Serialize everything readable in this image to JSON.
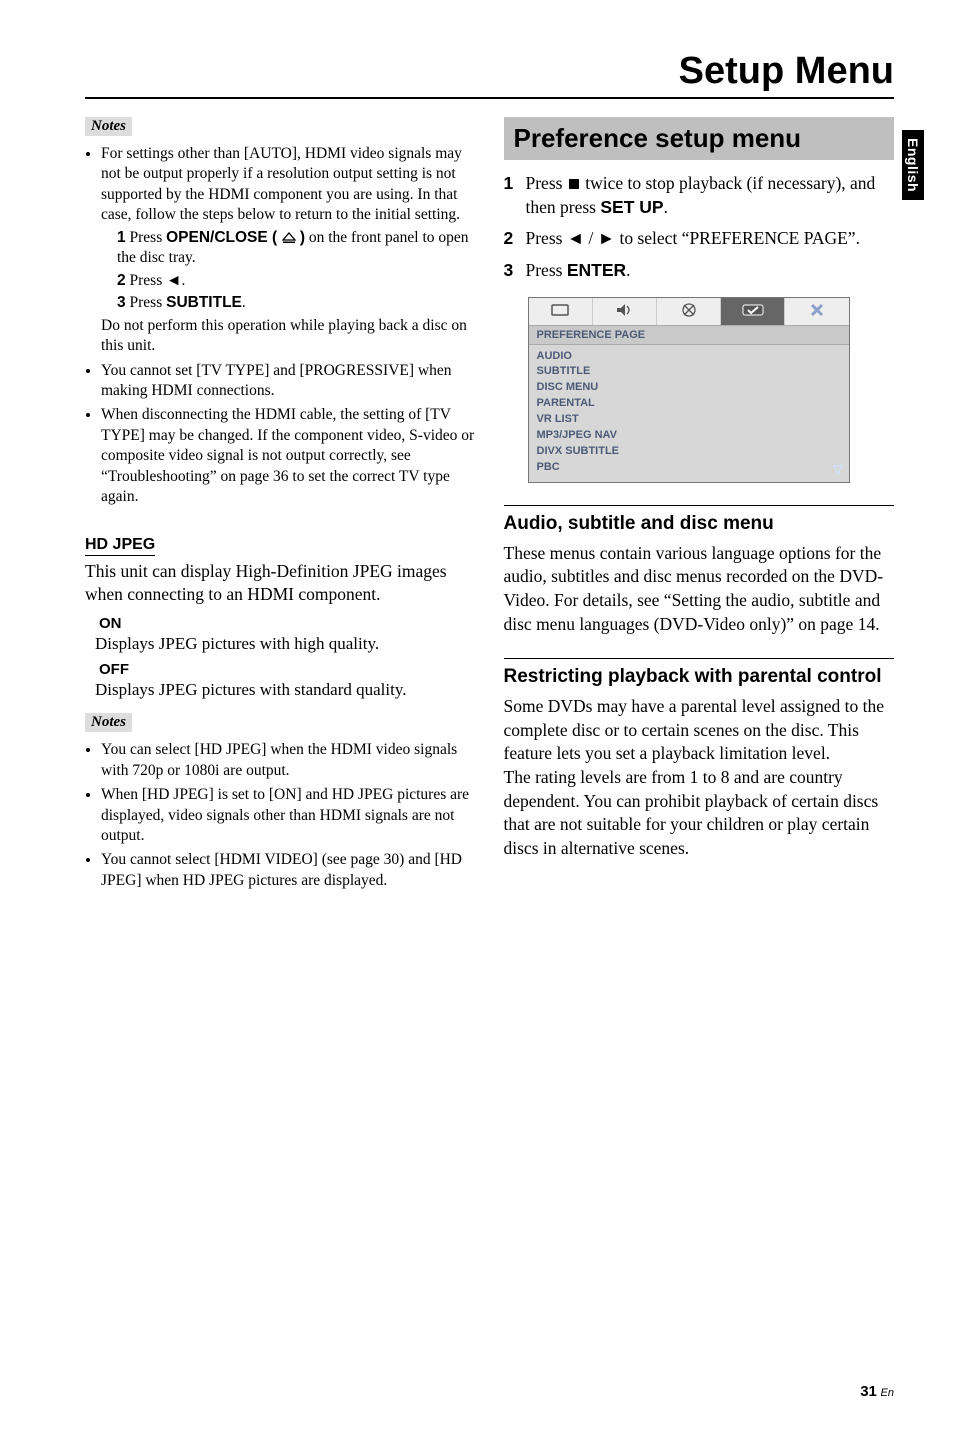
{
  "header": {
    "title": "Setup Menu"
  },
  "side_tab": "English",
  "footer": {
    "page": "31",
    "lang": "En"
  },
  "left": {
    "notes_label": "Notes",
    "note1_a": "For settings other than [AUTO], HDMI video signals may not be output properly if a resolution output setting is not supported by the HDMI component you are using. In that case, follow the steps below to return to the initial setting.",
    "note1_step1_pre": "Press ",
    "note1_step1_cmd": "OPEN/CLOSE ( ",
    "note1_step1_cmd2": " )",
    "note1_step1_post": " on the front panel to open the disc tray.",
    "note1_step2_pre": "Press ",
    "note1_step2_sym": "◄",
    "note1_step2_post": ".",
    "note1_step3_pre": "Press ",
    "note1_step3_cmd": "SUBTITLE",
    "note1_step3_post": ".",
    "note1_tail": "Do not perform this operation while playing back a disc on this unit.",
    "note2": "You cannot set [TV TYPE] and [PROGRESSIVE] when making HDMI connections.",
    "note3": "When disconnecting the HDMI cable, the setting of [TV TYPE] may be changed. If the component video, S-video or composite video signal is not output correctly, see “Troubleshooting” on page 36 to set the correct TV type again.",
    "hd_jpeg_head": "HD JPEG",
    "hd_jpeg_body": "This unit can display High-Definition JPEG images when connecting to an HDMI component.",
    "on_label": "ON",
    "on_desc": "Displays JPEG pictures with high quality.",
    "off_label": "OFF",
    "off_desc": "Displays JPEG pictures with standard quality.",
    "notes2_label": "Notes",
    "n2_1": "You can select [HD JPEG] when the HDMI video signals with 720p or 1080i are output.",
    "n2_2": "When [HD JPEG] is set to [ON] and HD JPEG pictures are displayed, video signals other than HDMI signals are not output.",
    "n2_3": "You cannot select [HDMI VIDEO] (see page 30) and [HD JPEG] when HD JPEG pictures are displayed."
  },
  "right": {
    "pref_head": "Preference setup menu",
    "step1_a": "Press ",
    "step1_b": " twice to stop playback (if necessary), and then press ",
    "step1_cmd": "SET UP",
    "step1_c": ".",
    "step2_a": "Press ",
    "step2_b": " to select “PREFERENCE PAGE”.",
    "step3_a": "Press ",
    "step3_cmd": "ENTER",
    "step3_b": ".",
    "osd": {
      "page_label": "PREFERENCE PAGE",
      "items": [
        "AUDIO",
        "SUBTITLE",
        "DISC MENU",
        "PARENTAL",
        "VR LIST",
        "MP3/JPEG NAV",
        "DIVX SUBTITLE",
        "PBC"
      ]
    },
    "sub1_head": "Audio, subtitle and disc menu",
    "sub1_body": "These menus contain various language options for the audio, subtitles and disc menus recorded on the DVD-Video. For details, see “Setting the audio, subtitle and disc menu languages (DVD-Video only)” on page 14.",
    "sub2_head": "Restricting playback with parental control",
    "sub2_body": "Some DVDs may have a parental level assigned to the complete disc or to certain scenes on the disc. This feature lets you set a playback limitation level.\nThe rating levels are from 1 to 8 and are country dependent. You can prohibit playback of certain discs that are not suitable for your children or play certain discs in alternative scenes."
  }
}
